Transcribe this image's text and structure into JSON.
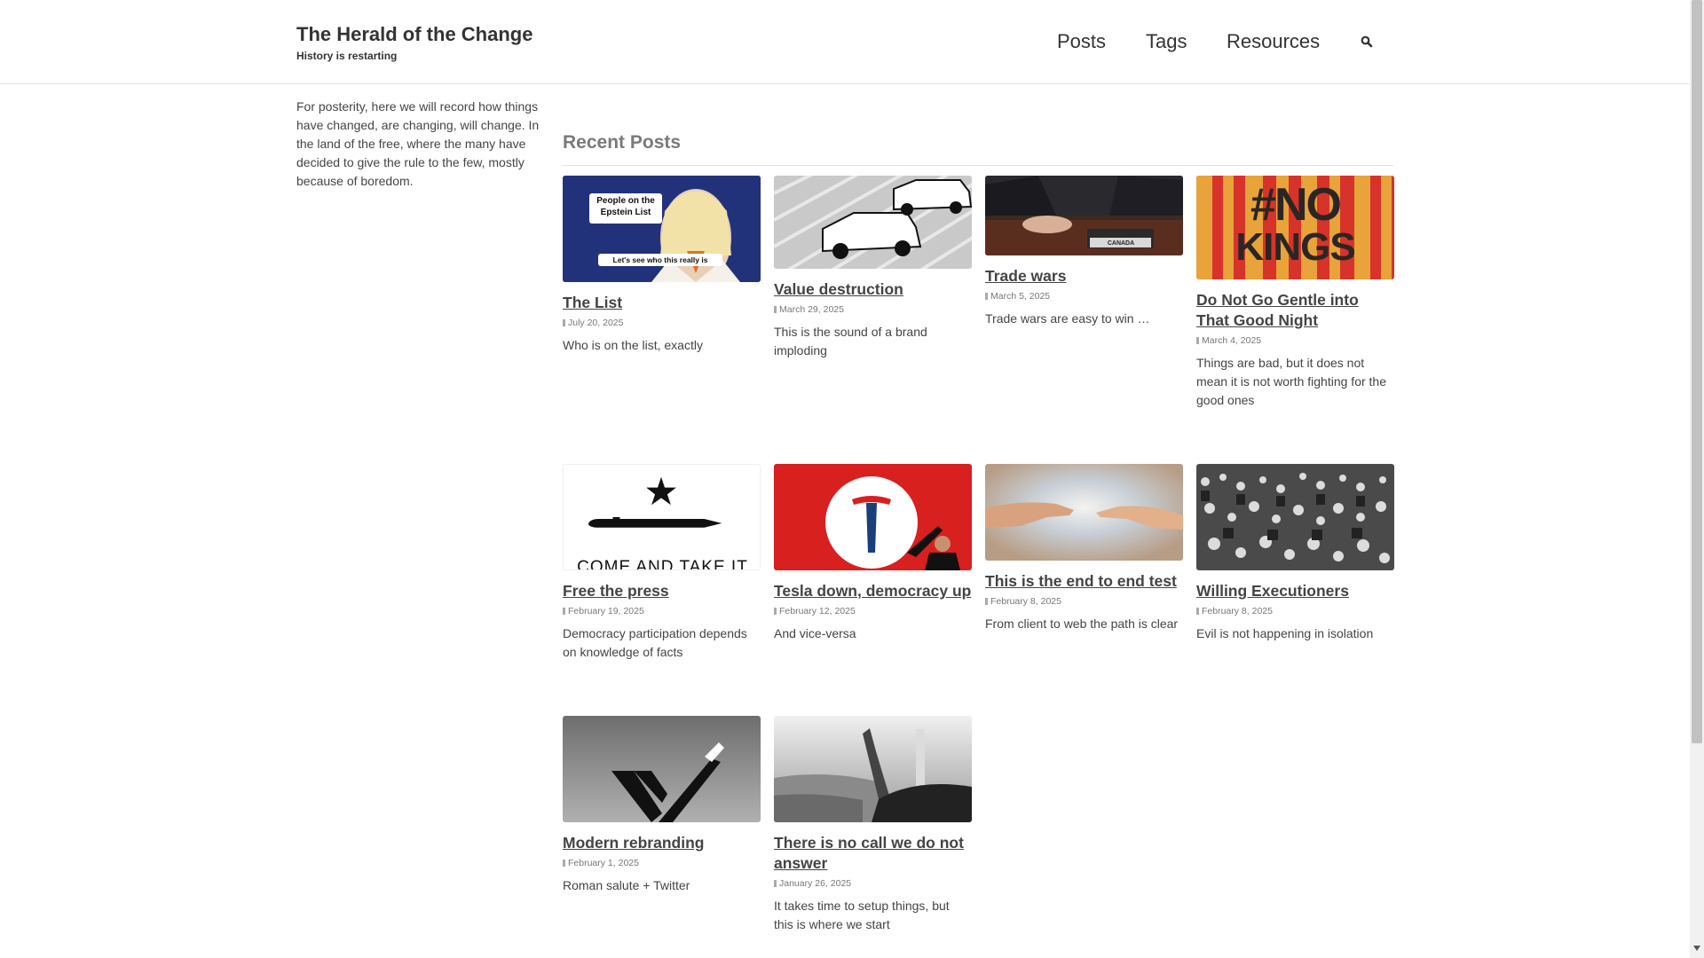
{
  "site": {
    "title": "The Herald of the Change",
    "tagline": "History is restarting"
  },
  "nav": {
    "posts": "Posts",
    "tags": "Tags",
    "resources": "Resources",
    "search_icon": "search-icon"
  },
  "sidebar": {
    "text": "For posterity, here we will record how things have changed, are changing, will change. In the land of the free, where the many have decided to give the rule to the few, mostly because of boredom."
  },
  "main": {
    "section_title": "Recent Posts",
    "posts": [
      {
        "title": "The List",
        "date": "July 20, 2025",
        "excerpt": "Who is on the list, exactly",
        "image_caption_top": "People on the Epstein List",
        "image_caption_bottom": "Let's see who this really is"
      },
      {
        "title": "Value destruction",
        "date": "March 29, 2025",
        "excerpt": "This is the sound of a brand imploding"
      },
      {
        "title": "Trade wars",
        "date": "March 5, 2025",
        "excerpt": "Trade wars are easy to win …",
        "image_text": "CANADA"
      },
      {
        "title": "Do Not Go Gentle into That Good Night",
        "date": "March 4, 2025",
        "excerpt": "Things are bad, but it does not mean it is not worth fighting for the good ones",
        "image_text_1": "#NO",
        "image_text_2": "KINGS"
      },
      {
        "title": "Free the press",
        "date": "February 19, 2025",
        "excerpt": "Democracy participation depends on knowledge of facts",
        "image_text": "COME AND TAKE IT"
      },
      {
        "title": "Tesla down, democracy up",
        "date": "February 12, 2025",
        "excerpt": "And vice-versa"
      },
      {
        "title": "This is the end to end test",
        "date": "February 8, 2025",
        "excerpt": "From client to web the path is clear"
      },
      {
        "title": "Willing Executioners",
        "date": "February 8, 2025",
        "excerpt": "Evil is not happening in isolation"
      },
      {
        "title": "Modern rebranding",
        "date": "February 1, 2025",
        "excerpt": "Roman salute + Twitter"
      },
      {
        "title": "There is no call we do not answer",
        "date": "January 26, 2025",
        "excerpt": "It takes time to setup things, but this is where we start"
      }
    ]
  }
}
